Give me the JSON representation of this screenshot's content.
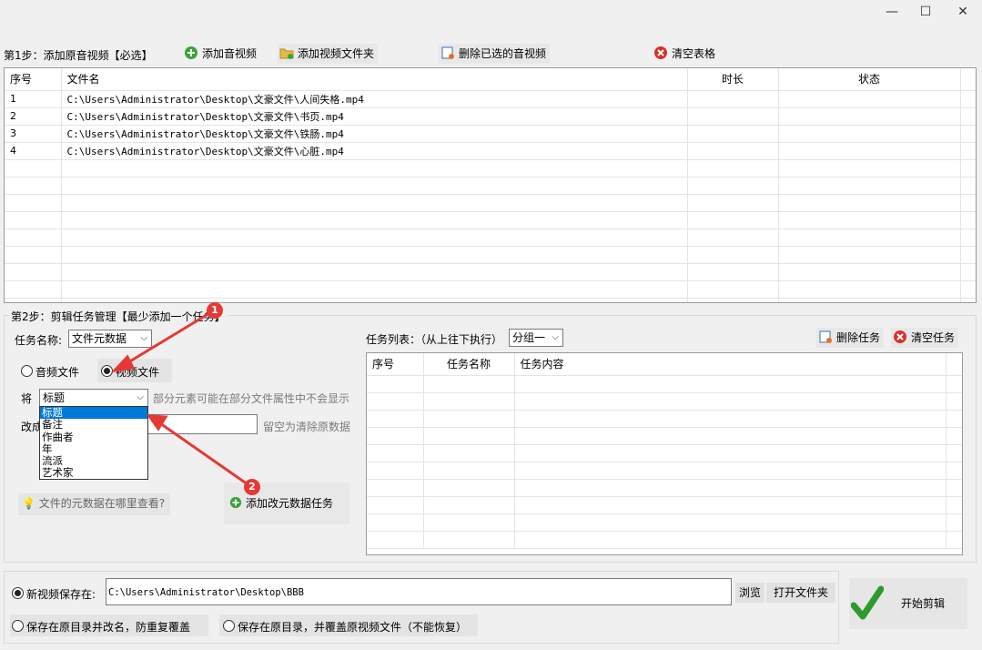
{
  "window": {
    "min_icon": "minimize-icon",
    "max_icon": "maximize-icon",
    "close_icon": "close-icon"
  },
  "step1": {
    "label": "第1步：添加原音视频【必选】",
    "add_audio": "添加音视频",
    "add_video_folder": "添加视频文件夹",
    "delete_selected": "删除已选的音视频",
    "clear_table": "清空表格",
    "columns": [
      "序号",
      "文件名",
      "时长",
      "状态"
    ],
    "rows": [
      {
        "no": "1",
        "file": "C:\\Users\\Administrator\\Desktop\\文豪文件\\人间失格.mp4",
        "duration": "",
        "status": ""
      },
      {
        "no": "2",
        "file": "C:\\Users\\Administrator\\Desktop\\文豪文件\\书页.mp4",
        "duration": "",
        "status": ""
      },
      {
        "no": "3",
        "file": "C:\\Users\\Administrator\\Desktop\\文豪文件\\铁肠.mp4",
        "duration": "",
        "status": ""
      },
      {
        "no": "4",
        "file": "C:\\Users\\Administrator\\Desktop\\文豪文件\\心脏.mp4",
        "duration": "",
        "status": ""
      }
    ]
  },
  "step2": {
    "label": "第2步：剪辑任务管理【最少添加一个任务】",
    "task_name_label": "任务名称:",
    "task_name_value": "文件元数据",
    "radio_audio": "音频文件",
    "radio_video": "视频文件",
    "field_label": "将",
    "field_value": "标题",
    "field_hint": "部分元素可能在部分文件属性中不会显示",
    "change_label": "改成",
    "change_hint": "留空为清除原数据",
    "dropdown_options": [
      "标题",
      "备注",
      "作曲者",
      "年",
      "流派",
      "艺术家"
    ],
    "help_link": "文件的元数据在哪里查看?",
    "add_task": "添加改元数据任务",
    "task_list_label": "任务列表：（从上往下执行）",
    "group_value": "分组一",
    "delete_task": "删除任务",
    "clear_tasks": "清空任务",
    "task_columns": [
      "序号",
      "任务名称",
      "任务内容"
    ]
  },
  "annotations": {
    "badge1": "1",
    "badge2": "2"
  },
  "output": {
    "radio_new_path": "新视频保存在:",
    "path_value": "C:\\Users\\Administrator\\Desktop\\BBB",
    "browse": "浏览",
    "open_folder": "打开文件夹",
    "radio_rename": "保存在原目录并改名，防重复覆盖",
    "radio_overwrite": "保存在原目录，并覆盖原视频文件（不能恢复）",
    "start": "开始剪辑"
  },
  "colors": {
    "accent": "#0078d7",
    "annotation": "#e53935"
  }
}
